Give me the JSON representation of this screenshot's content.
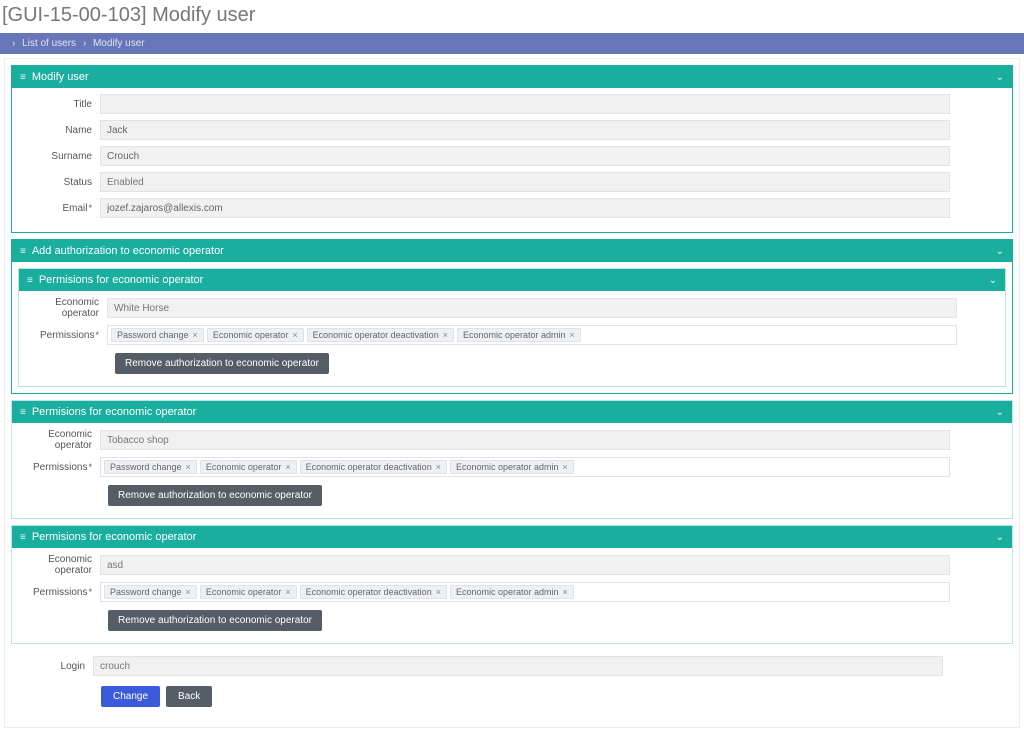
{
  "page_title": "[GUI-15-00-103] Modify user",
  "breadcrumb": {
    "items": [
      "List of users",
      "Modify user"
    ]
  },
  "panels": {
    "modify_user": {
      "title": "Modify user"
    },
    "add_auth": {
      "title": "Add authorization to economic operator"
    },
    "perm1": {
      "title": "Permisions for economic operator"
    },
    "perm2": {
      "title": "Permisions for economic operator"
    },
    "perm3": {
      "title": "Permisions for economic operator"
    }
  },
  "labels": {
    "title_field": "Title",
    "name": "Name",
    "surname": "Surname",
    "status": "Status",
    "email": "Email",
    "economic_operator": "Economic operator",
    "permissions": "Permissions",
    "login": "Login"
  },
  "values": {
    "title_field": "",
    "name": "Jack",
    "surname": "Crouch",
    "status": "Enabled",
    "email": "jozef.zajaros@allexis.com",
    "login": "crouch"
  },
  "perm_tags": {
    "t0": "Password change",
    "t1": "Economic operator",
    "t2": "Economic operator deactivation",
    "t3": "Economic operator admin"
  },
  "operators": {
    "op1": "White Horse",
    "op2": "Tobacco shop",
    "op3": "asd"
  },
  "buttons": {
    "remove_auth": "Remove authorization to economic operator",
    "change": "Change",
    "back": "Back"
  }
}
